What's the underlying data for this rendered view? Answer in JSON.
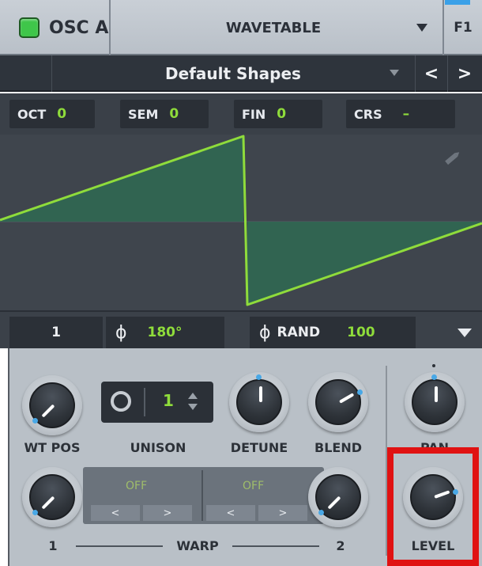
{
  "header": {
    "osc_label": "OSC A",
    "type_label": "WAVETABLE",
    "filter_label": "F1",
    "led_color": "#3fc64a"
  },
  "preset": {
    "name": "Default Shapes",
    "prev_glyph": "<",
    "next_glyph": ">"
  },
  "pitch": [
    {
      "label": "OCT",
      "value": "0"
    },
    {
      "label": "SEM",
      "value": "0"
    },
    {
      "label": "FIN",
      "value": "0"
    },
    {
      "label": "CRS",
      "value": "–"
    }
  ],
  "strip": {
    "wt_index": "1",
    "phase_symbol": "ϕ",
    "phase_value": "180°",
    "rand_symbol": "ϕ",
    "rand_label": "RAND",
    "rand_value": "100"
  },
  "knobs": {
    "wt_pos": "WT POS",
    "unison": "UNISON",
    "detune": "DETUNE",
    "blend": "BLEND",
    "pan": "PAN",
    "warp1": "1",
    "warp": "WARP",
    "warp2": "2",
    "level": "LEVEL"
  },
  "unison": {
    "value": "1"
  },
  "warp": {
    "slot1": "OFF",
    "slot2": "OFF",
    "left": "<",
    "right": ">"
  },
  "colors": {
    "accent_green": "#8fdc3b",
    "wave_fill": "#2f6a52",
    "highlight": "#e01212",
    "knob_marker": "#49a8e6"
  }
}
